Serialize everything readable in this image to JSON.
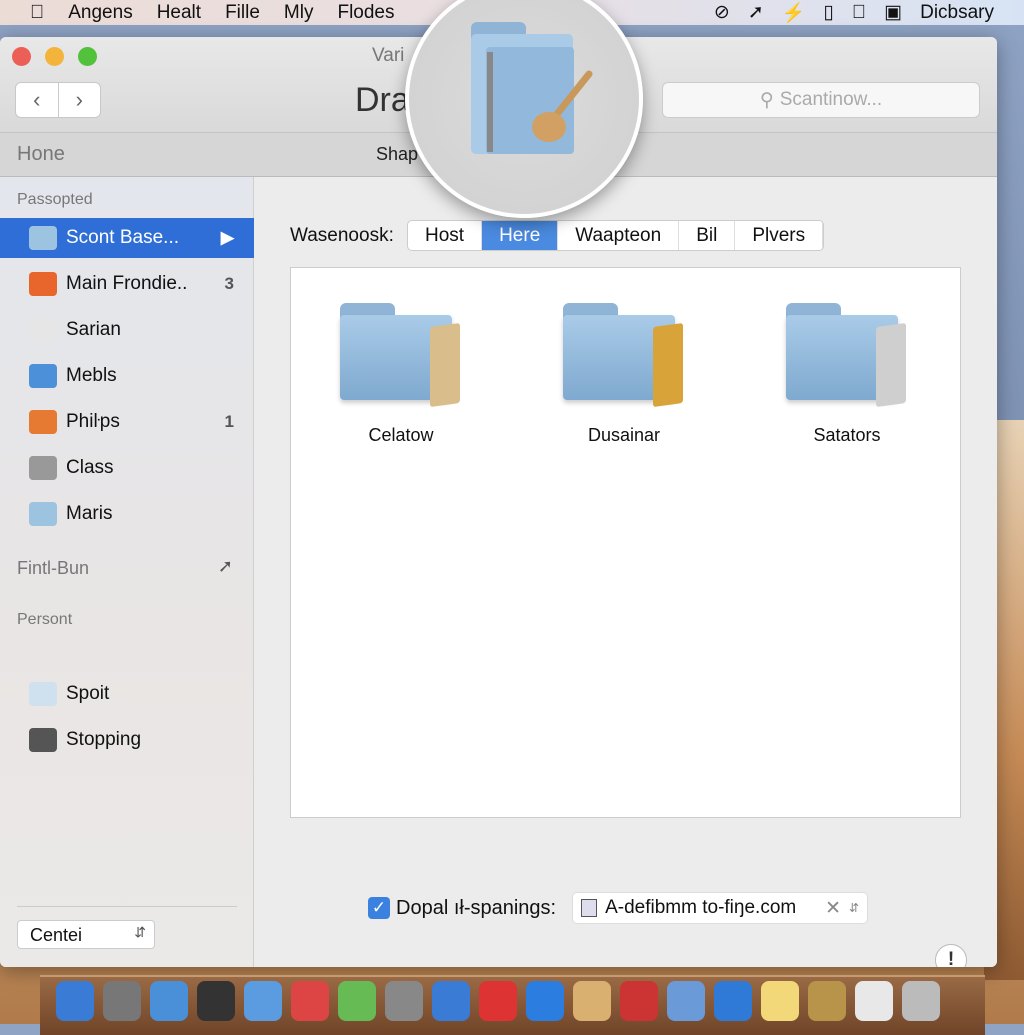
{
  "menubar": {
    "items": [
      "Angens",
      "Healt",
      "Fille",
      "Mly",
      "Flodes"
    ],
    "right_label": "Dicbsary",
    "status_icons": [
      "clock-icon",
      "send-icon",
      "bolt-icon",
      "cup-icon",
      "apple-icon",
      "battery-icon"
    ]
  },
  "window": {
    "title": "Vari",
    "big_title": "Dra",
    "search_placeholder": "Scantinow...",
    "toolbar_left": "Hone",
    "toolbar_center": "Shap"
  },
  "sidebar": {
    "section1": "Passopted",
    "items": [
      {
        "label": "Scont Base...",
        "badge": "▶",
        "color": "#9cc3e0"
      },
      {
        "label": "Main Frondie..",
        "badge": "3",
        "color": "#e8662c"
      },
      {
        "label": "Sarian",
        "badge": "",
        "color": "#e6e6e6"
      },
      {
        "label": "Mebls",
        "badge": "",
        "color": "#4b90d8"
      },
      {
        "label": "Phiŀps",
        "badge": "1",
        "color": "#e67a32"
      },
      {
        "label": "Class",
        "badge": "",
        "color": "#999"
      },
      {
        "label": "Maris",
        "badge": "",
        "color": "#9cc3e0"
      }
    ],
    "section2": "Fintl-Bun",
    "section2_icon": "arrow-icon",
    "section3": "Persont",
    "items2": [
      {
        "label": "Spoit",
        "color": "#cfe0ef"
      },
      {
        "label": "Stopping",
        "color": "#555"
      }
    ],
    "popup": "Centei"
  },
  "main": {
    "tab_label": "Wasenoosk:",
    "tabs": [
      "Host",
      "Here",
      "Waapteon",
      "Bil",
      "Plvers"
    ],
    "selected_tab": "Here",
    "folders": [
      {
        "label": "Celatow"
      },
      {
        "label": "Dusainar"
      },
      {
        "label": "Satators"
      }
    ],
    "checkbox_label": "Dopal ıł-spanings:",
    "checkbox_checked": true,
    "field_value": "A-defibmm to-fiŋe.com",
    "help": "!"
  },
  "dock": [
    "#3a7bd5",
    "#777",
    "#4a90d8",
    "#333",
    "#5b9be0",
    "#d44",
    "#6b5",
    "#888",
    "#3a7bd5",
    "#d33",
    "#2b7de0",
    "#d9b070",
    "#c33",
    "#6a9ad8",
    "#2f7ad6",
    "#f2d878",
    "#b8934a",
    "#e8e8e8",
    "#bbb"
  ]
}
